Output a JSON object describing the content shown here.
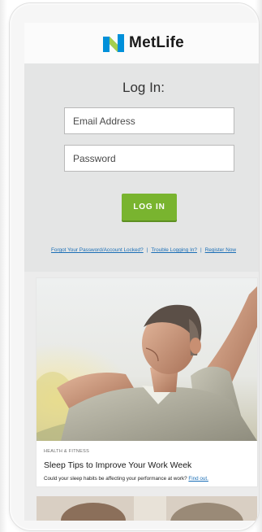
{
  "brand": {
    "name": "MetLife",
    "logo_icon": "metlife-m-icon",
    "logo_colors": [
      "#0090da",
      "#00a88e",
      "#a4ce4e"
    ]
  },
  "login": {
    "title": "Log In:",
    "email_placeholder": "Email Address",
    "password_placeholder": "Password",
    "button_label": "LOG IN",
    "button_color": "#79b42f"
  },
  "links": {
    "forgot": "Forgot Your Password/Account Locked?",
    "separator": "|",
    "trouble": "Trouble Logging In?",
    "register": "Register Now",
    "color": "#1a6eb6"
  },
  "article": {
    "category": "HEALTH & FITNESS",
    "title": "Sleep Tips to Improve Your Work Week",
    "description": "Could your sleep habits be affecting your performance at work?",
    "link_text": "Find out."
  }
}
